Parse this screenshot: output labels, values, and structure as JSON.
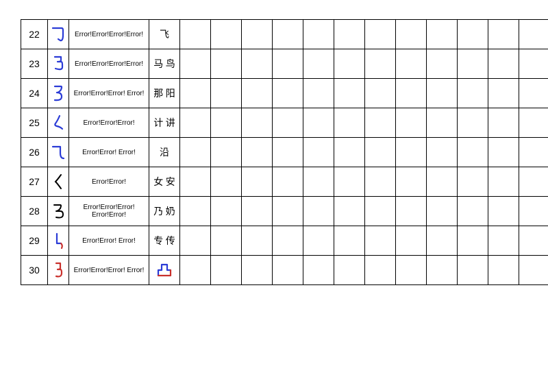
{
  "rows": [
    {
      "num": "22",
      "desc": "Error!Error!Error!Error!",
      "example": "飞"
    },
    {
      "num": "23",
      "desc": "Error!Error!Error!Error!",
      "example": "马 鸟"
    },
    {
      "num": "24",
      "desc": "Error!Error!Error! Error!",
      "example": "那 阳"
    },
    {
      "num": "25",
      "desc": "Error!Error!Error!",
      "example": "计 讲"
    },
    {
      "num": "26",
      "desc": "Error!Error! Error!",
      "example": "沿"
    },
    {
      "num": "27",
      "desc": "Error!Error!",
      "example": "女 安"
    },
    {
      "num": "28",
      "desc": "Error!Error!Error! Error!Error!",
      "example": "乃 奶"
    },
    {
      "num": "29",
      "desc": "Error!Error! Error!",
      "example": "专 传"
    },
    {
      "num": "30",
      "desc": "Error!Error!Error! Error!",
      "example": "凸"
    }
  ]
}
